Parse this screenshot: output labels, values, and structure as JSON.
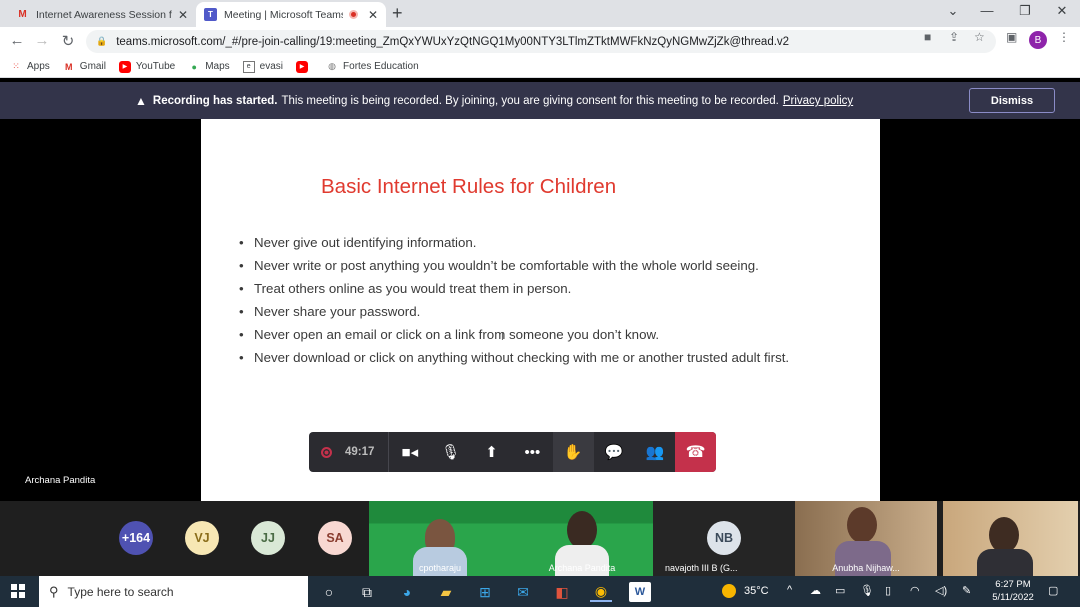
{
  "browser": {
    "tabs": [
      {
        "title": "Internet Awareness Session for P...",
        "icon": "gmail-icon"
      },
      {
        "title": "Meeting | Microsoft Teams",
        "icon": "teams-icon"
      }
    ],
    "url": "teams.microsoft.com/_#/pre-join-calling/19:meeting_ZmQxYWUxYzQtNGQ1My00NTY3LTlmZTktMWFkNzQyNGMwZjZk@thread.v2",
    "profile_initial": "B",
    "bookmarks": [
      "Apps",
      "Gmail",
      "YouTube",
      "Maps",
      "evasi",
      "",
      "Fortes Education"
    ]
  },
  "banner": {
    "bold": "Recording has started.",
    "text": "This meeting is being recorded. By joining, you are giving consent for this meeting to be recorded.",
    "link": "Privacy policy",
    "dismiss": "Dismiss"
  },
  "slide": {
    "title": "Basic Internet Rules for Children",
    "bullets": [
      "Never give out identifying information.",
      "Never write or post anything you wouldn’t be comfortable with the whole world seeing.",
      "Treat others online as you would treat them in person.",
      "Never share your password.",
      "Never open an email or click on a link from someone you don’t know.",
      "Never download or click on anything without checking with me or another trusted adult first."
    ]
  },
  "presenter": "Archana Pandita",
  "controls": {
    "timer": "49:17"
  },
  "participants": {
    "overflow": "+164",
    "avatars": [
      {
        "initials": "VJ",
        "bg": "#f7e7b4",
        "fg": "#8a6d1a"
      },
      {
        "initials": "JJ",
        "bg": "#d9e8d6",
        "fg": "#4a6b45"
      },
      {
        "initials": "SA",
        "bg": "#f8d8d2",
        "fg": "#8a3d30"
      }
    ],
    "video": [
      {
        "name": "cpotharaju"
      },
      {
        "name": "Archana Pandita"
      },
      {
        "name": "navajoth III B (G..."
      },
      {
        "name": "Anubha Nijhaw..."
      }
    ],
    "nb_initials": "NB"
  },
  "taskbar": {
    "search_placeholder": "Type here to search",
    "temperature": "35°C",
    "time": "6:27 PM",
    "date": "5/11/2022"
  }
}
